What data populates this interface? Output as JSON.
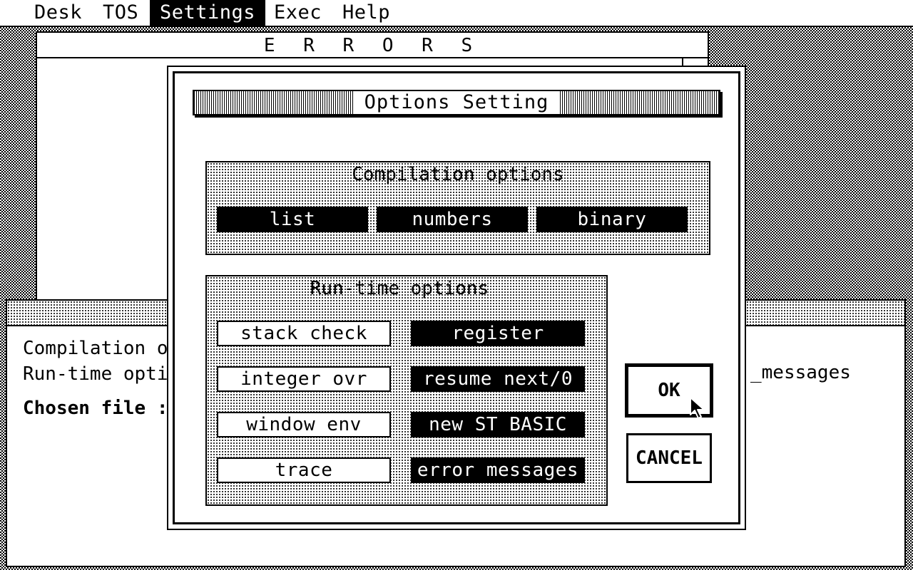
{
  "menubar": {
    "items": [
      {
        "label": "Desk",
        "active": false
      },
      {
        "label": "TOS",
        "active": false
      },
      {
        "label": "Settings",
        "active": true
      },
      {
        "label": "Exec",
        "active": false
      },
      {
        "label": "Help",
        "active": false
      }
    ]
  },
  "errors_window": {
    "title": "E R R O R S"
  },
  "info_window": {
    "line1": "Compilation o",
    "line2": "Run-time opti",
    "chosen_file": "Chosen file :",
    "right_fragment": "_messages"
  },
  "dialog": {
    "title": "Options Setting",
    "compilation": {
      "label": "Compilation options",
      "options": [
        {
          "label": "list",
          "selected": true
        },
        {
          "label": "numbers",
          "selected": true
        },
        {
          "label": "binary",
          "selected": true
        }
      ]
    },
    "runtime": {
      "label": "Run-time options",
      "left_options": [
        {
          "label": "stack check",
          "selected": false
        },
        {
          "label": "integer ovr",
          "selected": false
        },
        {
          "label": "window env",
          "selected": false
        },
        {
          "label": "trace",
          "selected": false
        }
      ],
      "right_options": [
        {
          "label": "register",
          "selected": true
        },
        {
          "label": "resume next/0",
          "selected": true
        },
        {
          "label": "new ST BASIC",
          "selected": true
        },
        {
          "label": "error messages",
          "selected": true
        }
      ]
    },
    "ok_label": "OK",
    "cancel_label": "CANCEL"
  },
  "icons": {
    "cursor": "arrow-cursor-icon"
  }
}
